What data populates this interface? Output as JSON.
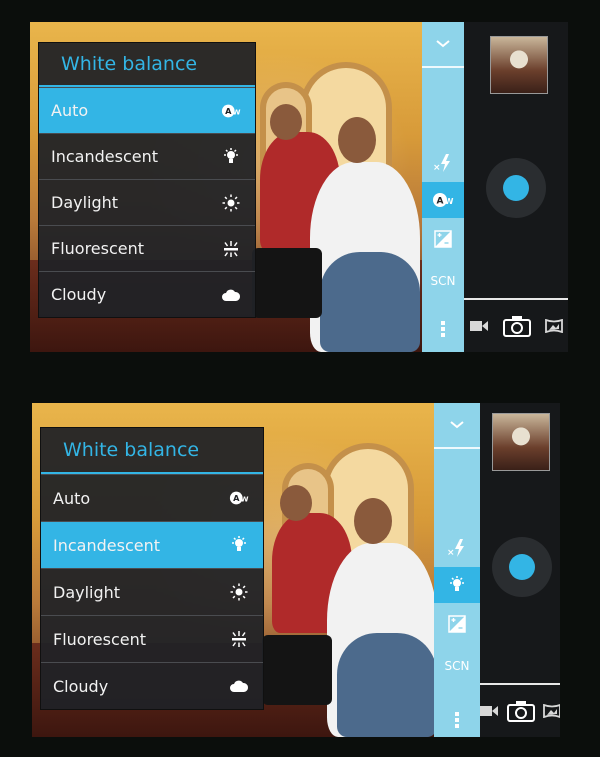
{
  "menus": [
    {
      "title": "White balance",
      "items": [
        {
          "label": "Auto",
          "icon": "auto-wb-icon",
          "selected": true
        },
        {
          "label": "Incandescent",
          "icon": "incandescent-icon",
          "selected": false
        },
        {
          "label": "Daylight",
          "icon": "daylight-icon",
          "selected": false
        },
        {
          "label": "Fluorescent",
          "icon": "fluorescent-icon",
          "selected": false
        },
        {
          "label": "Cloudy",
          "icon": "cloudy-icon",
          "selected": false
        }
      ],
      "strip_active": "auto-wb-icon"
    },
    {
      "title": "White balance",
      "items": [
        {
          "label": "Auto",
          "icon": "auto-wb-icon",
          "selected": false
        },
        {
          "label": "Incandescent",
          "icon": "incandescent-icon",
          "selected": true
        },
        {
          "label": "Daylight",
          "icon": "daylight-icon",
          "selected": false
        },
        {
          "label": "Fluorescent",
          "icon": "fluorescent-icon",
          "selected": false
        },
        {
          "label": "Cloudy",
          "icon": "cloudy-icon",
          "selected": false
        }
      ],
      "strip_active": "incandescent-icon"
    }
  ],
  "strip": {
    "scene_label": "SCN",
    "icons": [
      "chevron-down-icon",
      "flash-auto-icon",
      "white-balance-icon",
      "exposure-icon",
      "scene-mode-icon",
      "more-options-icon"
    ]
  },
  "mode_bar": {
    "icons": [
      "video-mode-icon",
      "camera-mode-icon",
      "panorama-mode-icon"
    ],
    "active": "camera-mode-icon"
  },
  "colors": {
    "accent": "#33b5e5",
    "strip": "#8ed4ea",
    "menu_bg": "#202226",
    "panel_bg": "#16181a"
  }
}
